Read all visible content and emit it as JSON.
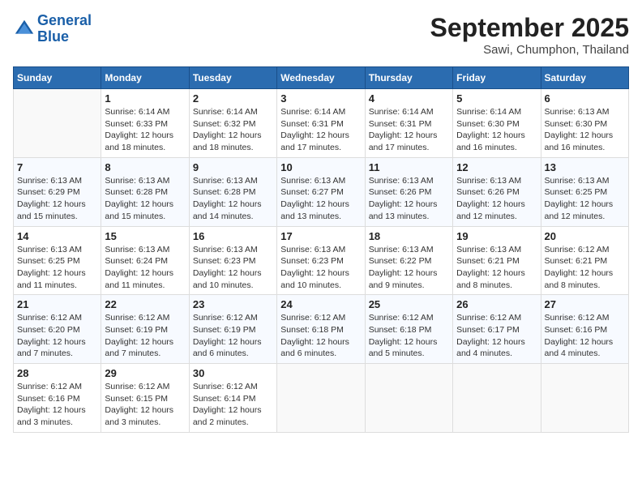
{
  "logo": {
    "line1": "General",
    "line2": "Blue"
  },
  "title": "September 2025",
  "location": "Sawi, Chumphon, Thailand",
  "weekdays": [
    "Sunday",
    "Monday",
    "Tuesday",
    "Wednesday",
    "Thursday",
    "Friday",
    "Saturday"
  ],
  "weeks": [
    [
      {
        "day": "",
        "info": ""
      },
      {
        "day": "1",
        "info": "Sunrise: 6:14 AM\nSunset: 6:33 PM\nDaylight: 12 hours\nand 18 minutes."
      },
      {
        "day": "2",
        "info": "Sunrise: 6:14 AM\nSunset: 6:32 PM\nDaylight: 12 hours\nand 18 minutes."
      },
      {
        "day": "3",
        "info": "Sunrise: 6:14 AM\nSunset: 6:31 PM\nDaylight: 12 hours\nand 17 minutes."
      },
      {
        "day": "4",
        "info": "Sunrise: 6:14 AM\nSunset: 6:31 PM\nDaylight: 12 hours\nand 17 minutes."
      },
      {
        "day": "5",
        "info": "Sunrise: 6:14 AM\nSunset: 6:30 PM\nDaylight: 12 hours\nand 16 minutes."
      },
      {
        "day": "6",
        "info": "Sunrise: 6:13 AM\nSunset: 6:30 PM\nDaylight: 12 hours\nand 16 minutes."
      }
    ],
    [
      {
        "day": "7",
        "info": "Sunrise: 6:13 AM\nSunset: 6:29 PM\nDaylight: 12 hours\nand 15 minutes."
      },
      {
        "day": "8",
        "info": "Sunrise: 6:13 AM\nSunset: 6:28 PM\nDaylight: 12 hours\nand 15 minutes."
      },
      {
        "day": "9",
        "info": "Sunrise: 6:13 AM\nSunset: 6:28 PM\nDaylight: 12 hours\nand 14 minutes."
      },
      {
        "day": "10",
        "info": "Sunrise: 6:13 AM\nSunset: 6:27 PM\nDaylight: 12 hours\nand 13 minutes."
      },
      {
        "day": "11",
        "info": "Sunrise: 6:13 AM\nSunset: 6:26 PM\nDaylight: 12 hours\nand 13 minutes."
      },
      {
        "day": "12",
        "info": "Sunrise: 6:13 AM\nSunset: 6:26 PM\nDaylight: 12 hours\nand 12 minutes."
      },
      {
        "day": "13",
        "info": "Sunrise: 6:13 AM\nSunset: 6:25 PM\nDaylight: 12 hours\nand 12 minutes."
      }
    ],
    [
      {
        "day": "14",
        "info": "Sunrise: 6:13 AM\nSunset: 6:25 PM\nDaylight: 12 hours\nand 11 minutes."
      },
      {
        "day": "15",
        "info": "Sunrise: 6:13 AM\nSunset: 6:24 PM\nDaylight: 12 hours\nand 11 minutes."
      },
      {
        "day": "16",
        "info": "Sunrise: 6:13 AM\nSunset: 6:23 PM\nDaylight: 12 hours\nand 10 minutes."
      },
      {
        "day": "17",
        "info": "Sunrise: 6:13 AM\nSunset: 6:23 PM\nDaylight: 12 hours\nand 10 minutes."
      },
      {
        "day": "18",
        "info": "Sunrise: 6:13 AM\nSunset: 6:22 PM\nDaylight: 12 hours\nand 9 minutes."
      },
      {
        "day": "19",
        "info": "Sunrise: 6:13 AM\nSunset: 6:21 PM\nDaylight: 12 hours\nand 8 minutes."
      },
      {
        "day": "20",
        "info": "Sunrise: 6:12 AM\nSunset: 6:21 PM\nDaylight: 12 hours\nand 8 minutes."
      }
    ],
    [
      {
        "day": "21",
        "info": "Sunrise: 6:12 AM\nSunset: 6:20 PM\nDaylight: 12 hours\nand 7 minutes."
      },
      {
        "day": "22",
        "info": "Sunrise: 6:12 AM\nSunset: 6:19 PM\nDaylight: 12 hours\nand 7 minutes."
      },
      {
        "day": "23",
        "info": "Sunrise: 6:12 AM\nSunset: 6:19 PM\nDaylight: 12 hours\nand 6 minutes."
      },
      {
        "day": "24",
        "info": "Sunrise: 6:12 AM\nSunset: 6:18 PM\nDaylight: 12 hours\nand 6 minutes."
      },
      {
        "day": "25",
        "info": "Sunrise: 6:12 AM\nSunset: 6:18 PM\nDaylight: 12 hours\nand 5 minutes."
      },
      {
        "day": "26",
        "info": "Sunrise: 6:12 AM\nSunset: 6:17 PM\nDaylight: 12 hours\nand 4 minutes."
      },
      {
        "day": "27",
        "info": "Sunrise: 6:12 AM\nSunset: 6:16 PM\nDaylight: 12 hours\nand 4 minutes."
      }
    ],
    [
      {
        "day": "28",
        "info": "Sunrise: 6:12 AM\nSunset: 6:16 PM\nDaylight: 12 hours\nand 3 minutes."
      },
      {
        "day": "29",
        "info": "Sunrise: 6:12 AM\nSunset: 6:15 PM\nDaylight: 12 hours\nand 3 minutes."
      },
      {
        "day": "30",
        "info": "Sunrise: 6:12 AM\nSunset: 6:14 PM\nDaylight: 12 hours\nand 2 minutes."
      },
      {
        "day": "",
        "info": ""
      },
      {
        "day": "",
        "info": ""
      },
      {
        "day": "",
        "info": ""
      },
      {
        "day": "",
        "info": ""
      }
    ]
  ]
}
